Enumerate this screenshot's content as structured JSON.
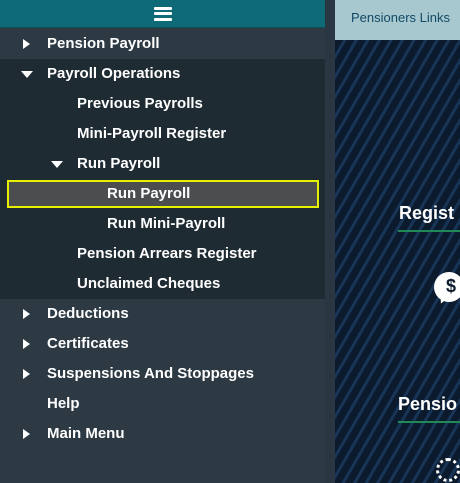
{
  "menu": {
    "items": [
      {
        "label": "Pension Payroll",
        "icon": "caret-right-icon"
      },
      {
        "label": "Payroll Operations",
        "icon": "caret-down-icon"
      },
      {
        "label": "Previous Payrolls"
      },
      {
        "label": "Mini-Payroll Register"
      },
      {
        "label": "Run Payroll",
        "icon": "caret-down-icon"
      },
      {
        "label": "Run Payroll",
        "selected": true
      },
      {
        "label": "Run Mini-Payroll"
      },
      {
        "label": "Pension Arrears Register"
      },
      {
        "label": "Unclaimed Cheques"
      },
      {
        "label": "Deductions",
        "icon": "caret-right-icon"
      },
      {
        "label": "Certificates",
        "icon": "caret-right-icon"
      },
      {
        "label": "Suspensions And Stoppages",
        "icon": "caret-right-icon"
      },
      {
        "label": "Help"
      },
      {
        "label": "Main Menu",
        "icon": "caret-right-icon"
      }
    ]
  },
  "header": {
    "tab_label": "Pensioners Links"
  },
  "content": {
    "heading_1": "Regist",
    "heading_2": "Pensio",
    "bubble_glyph": "$"
  },
  "colors": {
    "sidebar_bg": "#2d3a43",
    "submenu_bg": "#1f2b33",
    "selected_border": "#e7f000",
    "accent_teal": "#0f6a77",
    "underline_green": "#1f8a55"
  }
}
